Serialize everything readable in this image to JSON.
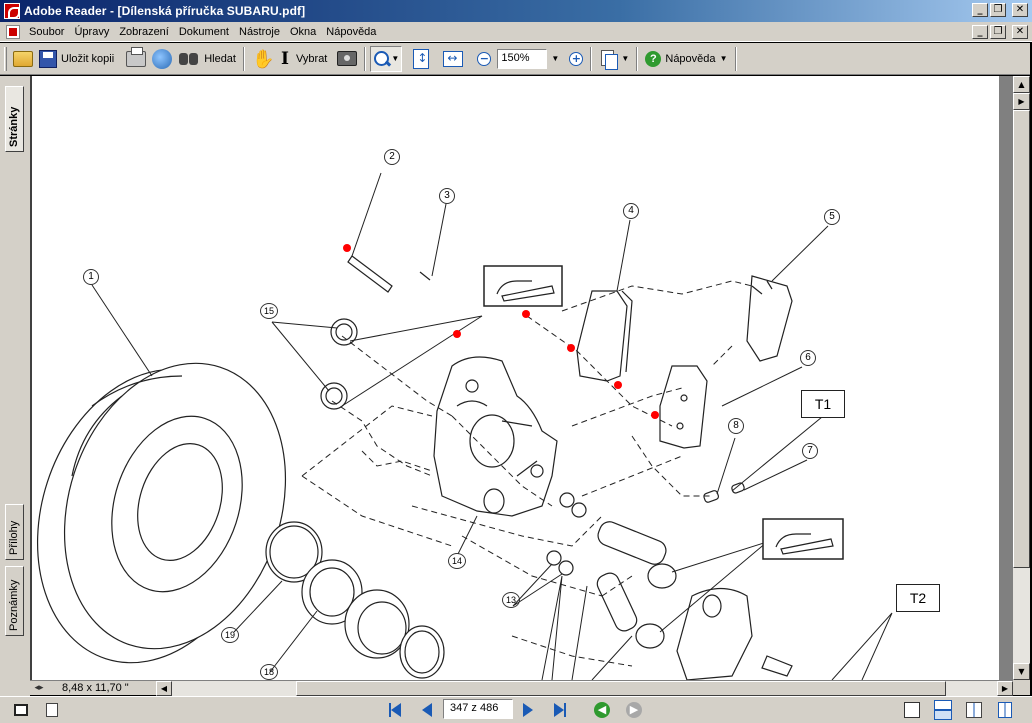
{
  "window": {
    "title": "Adobe Reader - [Dílenská příručka SUBARU.pdf]",
    "min_glyph": "_",
    "restore_glyph": "❐",
    "close_glyph": "✕"
  },
  "menu": {
    "items": [
      "Soubor",
      "Úpravy",
      "Zobrazení",
      "Dokument",
      "Nástroje",
      "Okna",
      "Nápověda"
    ]
  },
  "toolbar": {
    "save_copy_label": "Uložit kopii",
    "search_label": "Hledat",
    "select_label": "Vybrat",
    "zoom_value": "150%",
    "help_label": "Nápověda",
    "icons": [
      "open-icon",
      "save-icon",
      "print-icon",
      "email-icon",
      "search-binoculars-icon",
      "hand-tool-icon",
      "select-text-icon",
      "snapshot-icon",
      "zoom-in-icon",
      "fit-page-icon",
      "fit-width-icon",
      "zoom-out-icon",
      "zoom-plus-icon",
      "pages-icon",
      "help-icon"
    ]
  },
  "nav_tabs": {
    "pages": "Stránky",
    "attachments": "Přílohy",
    "comments": "Poznámky"
  },
  "document": {
    "page_size": "8,48 x 11,70 \"",
    "diagram": {
      "part_numbers": [
        "1",
        "2",
        "3",
        "4",
        "5",
        "6",
        "7",
        "8",
        "13",
        "14",
        "15",
        "18",
        "19"
      ],
      "callout_boxes": [
        "T1",
        "T2"
      ]
    }
  },
  "statusbar": {
    "page_indicator": "347 z 486"
  },
  "colors": {
    "chrome": "#d4d0c8",
    "title_start": "#0a246a",
    "title_end": "#a6caf0",
    "accent": "#1a5ab5",
    "marker": "#ff0000"
  }
}
